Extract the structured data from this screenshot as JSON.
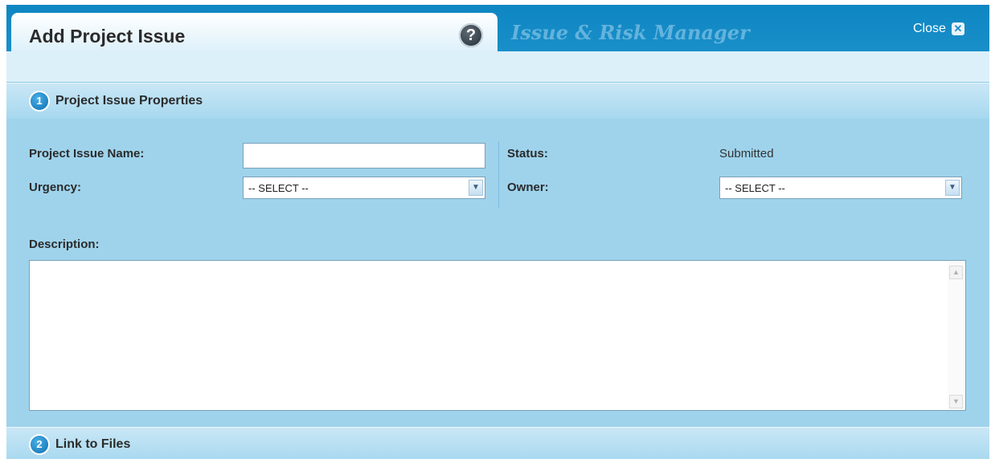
{
  "dialog": {
    "title": "Add Project Issue",
    "help_icon": "question-mark-icon",
    "app_title": "Issue & Risk Manager",
    "close_label": "Close",
    "close_icon": "close-icon"
  },
  "sections": [
    {
      "number": "1",
      "title": "Project Issue Properties"
    },
    {
      "number": "2",
      "title": "Link to Files"
    }
  ],
  "form": {
    "issue_name_label": "Project Issue Name:",
    "issue_name_value": "",
    "urgency_label": "Urgency:",
    "urgency_selected": "-- SELECT --",
    "status_label": "Status:",
    "status_value": "Submitted",
    "owner_label": "Owner:",
    "owner_selected": "-- SELECT --",
    "description_label": "Description:",
    "description_value": ""
  },
  "colors": {
    "header_blue": "#1a8fc9",
    "panel_blue": "#9fd3ec",
    "step_blue": "#0c6fb0"
  }
}
